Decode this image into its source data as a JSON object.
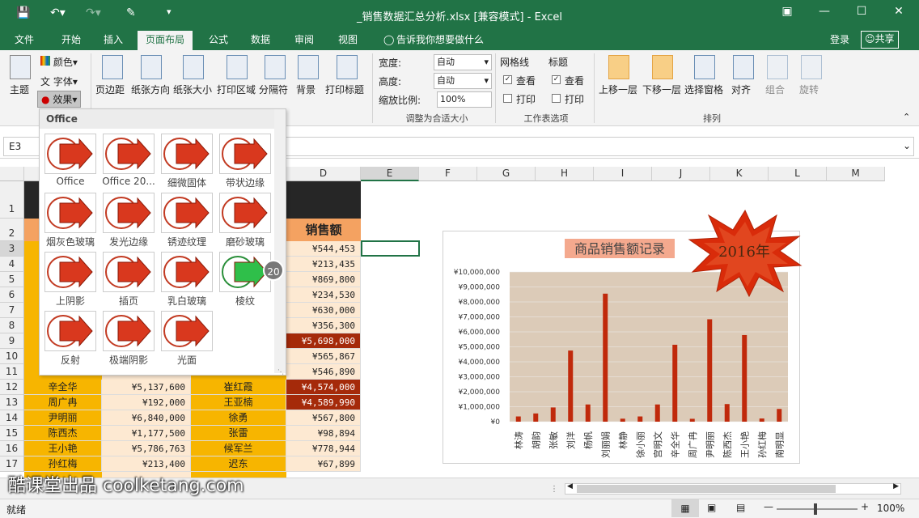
{
  "window": {
    "title": "_销售数据汇总分析.xlsx  [兼容模式] - Excel",
    "min_icon": "minimize-icon",
    "max_icon": "maximize-icon",
    "close_icon": "close-icon"
  },
  "tabs": [
    "文件",
    "开始",
    "插入",
    "页面布局",
    "公式",
    "数据",
    "审阅",
    "视图"
  ],
  "tell_me": "告诉我你想要做什么",
  "login": "登录",
  "share": "共享",
  "ribbon": {
    "theme": "主题",
    "colors": "颜色",
    "fonts": "字体",
    "effects": "效果",
    "margins": "页边距",
    "orientation": "纸张方向",
    "size": "纸张大小",
    "print_area": "打印区域",
    "breaks": "分隔符",
    "background": "背景",
    "print_titles": "打印标题",
    "width_label": "宽度:",
    "width_val": "自动",
    "height_label": "高度:",
    "height_val": "自动",
    "scale_label": "缩放比例:",
    "scale_val": "100%",
    "scale_group": "调整为合适大小",
    "gridlines": "网格线",
    "headings": "标题",
    "view": "查看",
    "print": "打印",
    "sheet_options": "工作表选项",
    "bring_forward": "上移一层",
    "send_backward": "下移一层",
    "selection_pane": "选择窗格",
    "align": "对齐",
    "group": "组合",
    "rotate": "旋转",
    "arrange": "排列"
  },
  "namebox": "E3",
  "columns": [
    "D",
    "E",
    "F",
    "G",
    "H",
    "I",
    "J",
    "K",
    "L",
    "M"
  ],
  "rows": [
    "1",
    "2",
    "3",
    "4",
    "5",
    "6",
    "7",
    "8",
    "9",
    "10",
    "11",
    "12",
    "13",
    "14",
    "15",
    "16",
    "17"
  ],
  "header_sales": "销售额",
  "d_values": [
    "¥544,453",
    "¥213,435",
    "¥869,800",
    "¥234,530",
    "¥630,000",
    "¥356,300",
    "¥5,698,000",
    "¥565,867",
    "¥546,890",
    "¥4,574,000",
    "¥4,589,990",
    "¥567,800",
    "¥98,894",
    "¥778,944",
    "¥67,899"
  ],
  "lower_rows": [
    {
      "a": "辛全华",
      "b": "¥5,137,600",
      "c": "崔红霞"
    },
    {
      "a": "周广冉",
      "b": "¥192,000",
      "c": "王亚楠"
    },
    {
      "a": "尹明丽",
      "b": "¥6,840,000",
      "c": "徐勇"
    },
    {
      "a": "陈西杰",
      "b": "¥1,177,500",
      "c": "张雷"
    },
    {
      "a": "王小艳",
      "b": "¥5,786,763",
      "c": "候军兰"
    },
    {
      "a": "孙红梅",
      "b": "¥213,400",
      "c": "迟东"
    }
  ],
  "gallery": {
    "section": "Office",
    "items": [
      "Office",
      "Office 20...",
      "细微固体",
      "带状边缘",
      "烟灰色玻璃",
      "发光边缘",
      "锈迹纹理",
      "磨砂玻璃",
      "上阴影",
      "插页",
      "乳白玻璃",
      "棱纹",
      "反射",
      "极端阴影",
      "光面"
    ],
    "badge": "20"
  },
  "chart_data": {
    "type": "bar",
    "title": "商品销售额记录",
    "callout": "2016年",
    "categories": [
      "林涛",
      "胡韵",
      "张敏",
      "刘洋",
      "杨帆",
      "刘丽娟",
      "林静",
      "徐小丽",
      "宫明文",
      "辛全华",
      "周广冉",
      "尹明丽",
      "陈西杰",
      "王小艳",
      "孙红梅",
      "南明显"
    ],
    "values": [
      350000,
      550000,
      950000,
      4750000,
      1150000,
      8550000,
      200000,
      350000,
      1150000,
      5137600,
      192000,
      6840000,
      1177500,
      5786763,
      213400,
      850000
    ],
    "ylim": [
      0,
      10000000
    ],
    "yticks": [
      "¥10,000,000",
      "¥9,000,000",
      "¥8,000,000",
      "¥7,000,000",
      "¥6,000,000",
      "¥5,000,000",
      "¥4,000,000",
      "¥3,000,000",
      "¥2,000,000",
      "¥1,000,000",
      "¥0"
    ],
    "colors": {
      "bar": "#c0290b",
      "plot_bg": "#dccbb8",
      "title_bg": "#f4a98e"
    }
  },
  "status": {
    "ready": "就绪",
    "zoom": "100%"
  },
  "watermark": "酷课堂出品 coolketang.com"
}
